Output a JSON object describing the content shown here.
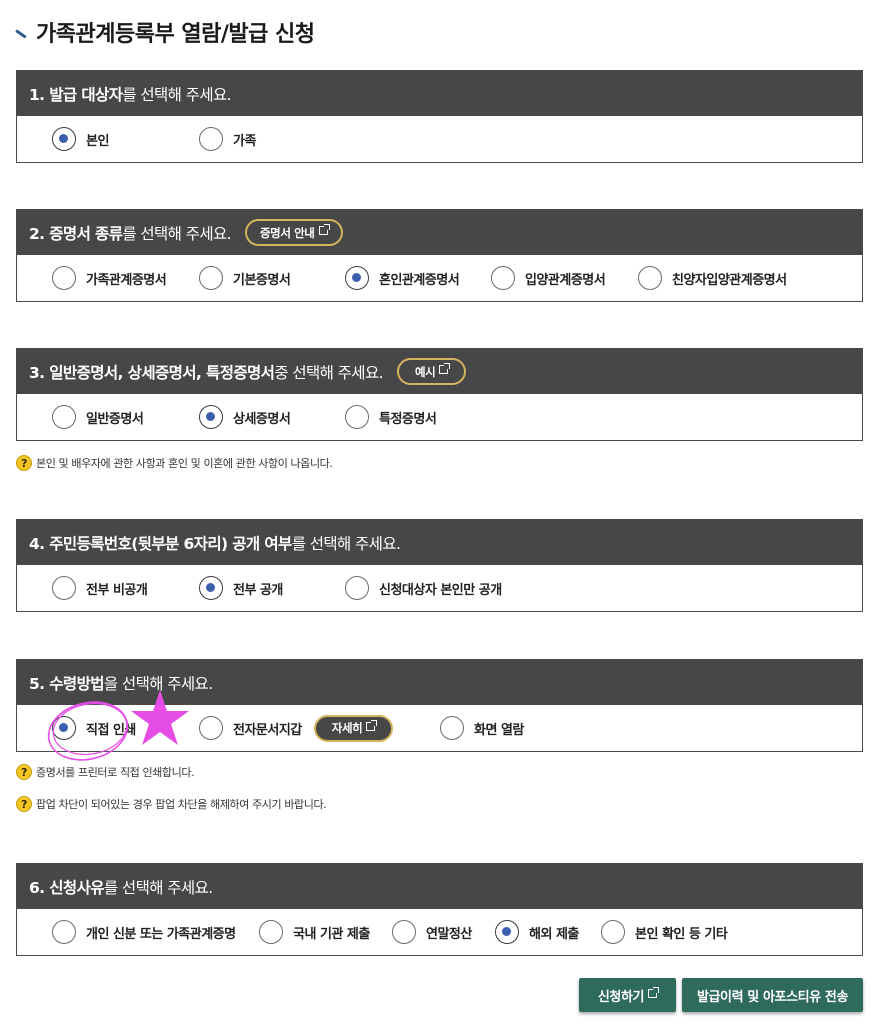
{
  "page": {
    "title": "가족관계등록부 열람/발급 신청"
  },
  "sections": [
    {
      "bold": "1. 발급 대상자",
      "rest": "를 선택해 주세요.",
      "options": [
        {
          "label": "본인",
          "selected": true
        },
        {
          "label": "가족",
          "selected": false
        }
      ]
    },
    {
      "bold": "2. 증명서 종류",
      "rest": "를 선택해 주세요.",
      "pill": "증명서 안내",
      "options": [
        {
          "label": "가족관계증명서",
          "selected": false
        },
        {
          "label": "기본증명서",
          "selected": false
        },
        {
          "label": "혼인관계증명서",
          "selected": true
        },
        {
          "label": "입양관계증명서",
          "selected": false
        },
        {
          "label": "친양자입양관계증명서",
          "selected": false
        }
      ]
    },
    {
      "bold": "3. 일반증명서, 상세증명서, 특정증명서",
      "rest": " 중 선택해 주세요.",
      "pill": "예시",
      "options": [
        {
          "label": "일반증명서",
          "selected": false
        },
        {
          "label": "상세증명서",
          "selected": true
        },
        {
          "label": "특정증명서",
          "selected": false
        }
      ]
    },
    {
      "bold": "4. 주민등록번호(뒷부분 6자리) 공개 여부",
      "rest": "를 선택해 주세요.",
      "options": [
        {
          "label": "전부 비공개",
          "selected": false
        },
        {
          "label": "전부 공개",
          "selected": true
        },
        {
          "label": "신청대상자 본인만 공개",
          "selected": false
        }
      ]
    },
    {
      "bold": "5. 수령방법",
      "rest": "을 선택해 주세요.",
      "options": [
        {
          "label": "직접 인쇄",
          "selected": true
        },
        {
          "label": "전자문서지갑",
          "selected": false
        },
        {
          "label": "화면 열람",
          "selected": false
        }
      ],
      "detail_pill": "자세히"
    },
    {
      "bold": "6. 신청사유",
      "rest": "를 선택해 주세요.",
      "options": [
        {
          "label": "개인 신분 또는 가족관계증명",
          "selected": false
        },
        {
          "label": "국내 기관 제출",
          "selected": false
        },
        {
          "label": "연말정산",
          "selected": false
        },
        {
          "label": "해외 제출",
          "selected": true
        },
        {
          "label": "본인 확인 등 기타",
          "selected": false
        }
      ]
    }
  ],
  "notes": {
    "section3": "본인 및 배우자에 관한 사항과 혼인 및 이혼에 관한 사항이 나옵니다.",
    "section5_a": "증명서를 프린터로 직접 인쇄합니다.",
    "section5_b": "팝업 차단이 되어있는 경우 팝업 차단을 해제하여 주시기 바랍니다."
  },
  "help_glyph": "?",
  "buttons": {
    "apply": "신청하기",
    "history": "발급이력 및 아포스티유 전송"
  },
  "colors": {
    "header_bg": "#474747",
    "radio_selected": "#3b5fb0",
    "pill_border": "#d4b45e",
    "button_bg": "#2f6b5c",
    "annotation": "#e64ce6"
  },
  "icons": [
    "title-mark-icon",
    "external-link-icon",
    "help-icon",
    "radio-icon",
    "star-annotation-icon"
  ]
}
